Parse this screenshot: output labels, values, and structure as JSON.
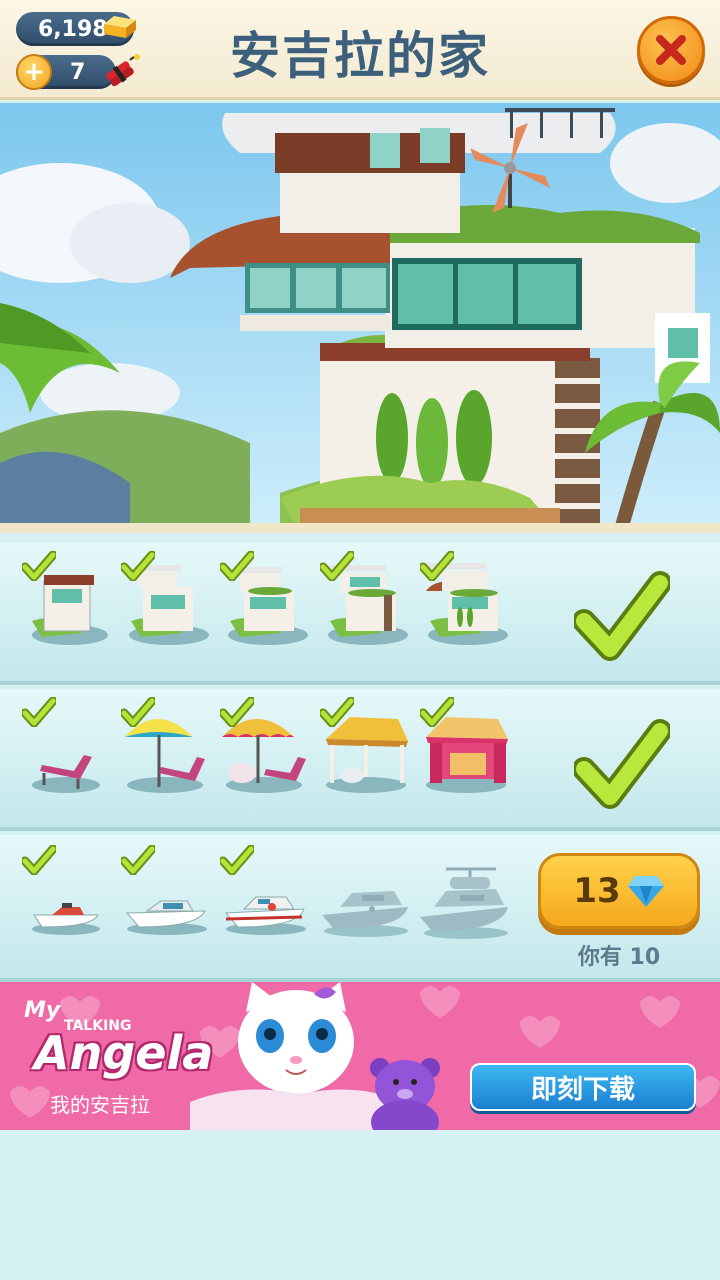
{
  "header": {
    "gold": "6,198",
    "dynamite": "7",
    "plus": "+",
    "title": "安吉拉的家"
  },
  "colors": {
    "accent_orange": "#f5a81c",
    "title_blue": "#3c5f7c",
    "check_green": "#9bd12a",
    "ad_pink": "#f06aa7",
    "download_blue": "#1b7fd1"
  },
  "rows": [
    {
      "name": "house",
      "items": [
        {
          "icon": "house-level-1-icon",
          "owned": true
        },
        {
          "icon": "house-level-2-icon",
          "owned": true
        },
        {
          "icon": "house-level-3-icon",
          "owned": true
        },
        {
          "icon": "house-level-4-icon",
          "owned": true
        },
        {
          "icon": "house-level-5-icon",
          "owned": true
        }
      ],
      "completed": true
    },
    {
      "name": "beach",
      "items": [
        {
          "icon": "lounge-chair-icon",
          "owned": true
        },
        {
          "icon": "umbrella-chair-icon",
          "owned": true
        },
        {
          "icon": "umbrella-table-chair-icon",
          "owned": true
        },
        {
          "icon": "gazebo-icon",
          "owned": true
        },
        {
          "icon": "cabana-icon",
          "owned": true
        }
      ],
      "completed": true
    },
    {
      "name": "boats",
      "items": [
        {
          "icon": "jet-ski-icon",
          "owned": true
        },
        {
          "icon": "speedboat-icon",
          "owned": true
        },
        {
          "icon": "motor-yacht-icon",
          "owned": true
        },
        {
          "icon": "locked-yacht-icon",
          "owned": false
        },
        {
          "icon": "locked-helicopter-yacht-icon",
          "owned": false
        }
      ],
      "completed": false,
      "price": "13",
      "price_icon": "diamond-icon",
      "you_have": "你有 10"
    }
  ],
  "ad": {
    "my": "My",
    "talking": "TALKING",
    "angela": "Angela",
    "subtitle": "我的安吉拉",
    "button": "即刻下载"
  }
}
